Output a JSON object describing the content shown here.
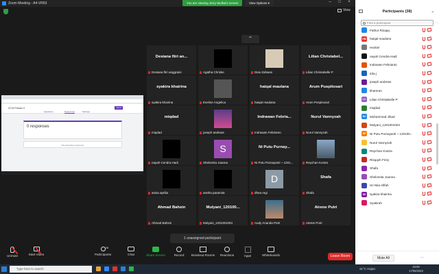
{
  "window": {
    "title": "Zoom Meeting - A4-VR63"
  },
  "banner": {
    "text": "You are viewing Jerry Wulkai's screen",
    "view_options": "View Options ▾"
  },
  "view_button": "View",
  "tiles": [
    {
      "name": "Desiana fitri an...",
      "label": "Desiana fitri anggraini",
      "video": "none"
    },
    {
      "name": "",
      "label": "Agatha Christie",
      "video": "black"
    },
    {
      "name": "",
      "label": "Dias Zahwan",
      "video": "photo"
    },
    {
      "name": "Lilian Christabel...",
      "label": "Lilian Christabelle P",
      "video": "none"
    },
    {
      "name": "syakira khairina",
      "label": "syakira khairina",
      "video": "none"
    },
    {
      "name": "",
      "label": "Eveline Angelica",
      "video": "gray"
    },
    {
      "name": "haiqal maulana",
      "label": "haiqal maulana",
      "video": "none"
    },
    {
      "name": "Arum Puspitosari",
      "label": "Arum Puspitosari",
      "video": "none"
    },
    {
      "name": "miqdad",
      "label": "miqdad",
      "video": "none"
    },
    {
      "name": "",
      "label": "joseph andreas",
      "video": "photo2"
    },
    {
      "name": "Indrawan Febria...",
      "label": "Indrawan Febrianto",
      "video": "none"
    },
    {
      "name": "Nurul Vannyzah",
      "label": "Nurul Vannyzah",
      "video": "none"
    },
    {
      "name": "",
      "label": "nayah Cendra Hadi",
      "video": "black"
    },
    {
      "name": "",
      "label": "Shelomita Joanna",
      "video": "S"
    },
    {
      "name": "Ni Putu Purnay...",
      "label": "Ni Putu Purnayanti ~ 1201...",
      "video": "none"
    },
    {
      "name": "",
      "label": "Reychan Kostra",
      "video": "photo3"
    },
    {
      "name": "",
      "label": "anisa aprilia",
      "video": "black"
    },
    {
      "name": "",
      "label": "aretha paramita",
      "video": "black"
    },
    {
      "name": "",
      "label": "dhea regi",
      "video": "D"
    },
    {
      "name": "Shafa",
      "label": "Shafa",
      "video": "none"
    },
    {
      "name": "Ahmad Bahsin",
      "label": "Ahmad Bahsin",
      "video": "none"
    },
    {
      "name": "Mulyani_120100...",
      "label": "Mulyani_1201001004",
      "video": "none"
    },
    {
      "name": "",
      "label": "Audy Ananda Putri",
      "video": "photo4"
    },
    {
      "name": "Airene Putri",
      "label": "Airene Putri",
      "video": "none"
    }
  ],
  "screenshare": {
    "doc_title": "ICCN Pranan II",
    "send_label": "Send",
    "tab_questions": "Questions",
    "tab_responses": "Responses",
    "tab_settings": "Settings",
    "responses": "0 responses",
    "not_accepting": "Not accepting responses"
  },
  "participants": {
    "title": "Participants (38)",
    "search_placeholder": "Find a participant",
    "mute_all": "Mute All",
    "more": "...",
    "list": [
      {
        "name": "Fathur Rizqaq",
        "initials": "",
        "color": "#1e88e5"
      },
      {
        "name": "haiqal maulana",
        "initials": "HM",
        "color": "#e53935"
      },
      {
        "name": "Heztiel",
        "initials": "",
        "color": "#777777"
      },
      {
        "name": "nayah Cendra Hadi",
        "initials": "",
        "color": "#111111"
      },
      {
        "name": "Indrawan Febrianto",
        "initials": "",
        "color": "#e65100"
      },
      {
        "name": "irda j",
        "initials": "",
        "color": "#1565c0"
      },
      {
        "name": "joseph andreas",
        "initials": "",
        "color": "#6a1b9a"
      },
      {
        "name": "khamran",
        "initials": "",
        "color": "#1e88e5"
      },
      {
        "name": "Lilian Christabelle P",
        "initials": "LC",
        "color": "#8e63ce"
      },
      {
        "name": "miqdad",
        "initials": "",
        "color": "#2e7d32"
      },
      {
        "name": "Muhammad Jihad",
        "initials": "MJ",
        "color": "#1e88e5"
      },
      {
        "name": "Mulyani_1201001004",
        "initials": "",
        "color": "#d84315"
      },
      {
        "name": "Ni Putu Purnayanti ~ 120100...",
        "initials": "NP",
        "color": "#f57c00"
      },
      {
        "name": "Nurul Vannyzah",
        "initials": "",
        "color": "#fbc02d"
      },
      {
        "name": "Reychan Kostra",
        "initials": "",
        "color": "#00897b"
      },
      {
        "name": "Risqqoh Firzy",
        "initials": "",
        "color": "#c62828"
      },
      {
        "name": "Shafa",
        "initials": "",
        "color": "#8e24aa"
      },
      {
        "name": "Shelomita Joanna",
        "initials": "",
        "color": "#9a4db1"
      },
      {
        "name": "Sri Nita Allfah",
        "initials": "",
        "color": "#3949ab"
      },
      {
        "name": "syakira khairina",
        "initials": "SK",
        "color": "#7b1fa2"
      },
      {
        "name": "Syakirah",
        "initials": "",
        "color": "#d81b60"
      }
    ]
  },
  "unassigned": "1 unassigned participant",
  "toolbar": {
    "unmute": "Unmute",
    "start_video": "Start Video",
    "participants": "Participants",
    "participants_count": "38",
    "chat": "Chat",
    "share_screen": "Share Screen",
    "record": "Record",
    "breakout": "Breakout Rooms",
    "reactions": "Reactions",
    "apps": "Apps",
    "whiteboards": "Whiteboards",
    "end": "Leave Room"
  },
  "taskbar": {
    "search": "Type here to search",
    "weather": "31°C Hujan",
    "time": "16:06",
    "date": "17/05/2022"
  }
}
